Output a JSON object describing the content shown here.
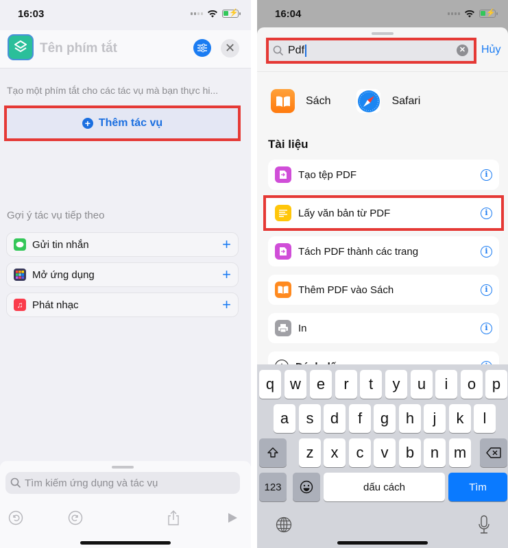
{
  "left": {
    "status": {
      "time": "16:03"
    },
    "header": {
      "title_placeholder": "Tên phím tắt",
      "app_icon": "shortcuts-layers-icon",
      "settings_icon": "sliders-icon",
      "close_icon": "close-icon"
    },
    "description": "Tạo một phím tắt cho các tác vụ mà bạn thực hi...",
    "add_action_label": "Thêm tác vụ",
    "suggestions_title": "Gợi ý tác vụ tiếp theo",
    "suggestions": [
      {
        "label": "Gửi tin nhắn",
        "icon": "messages-icon",
        "color": "#34c759"
      },
      {
        "label": "Mở ứng dụng",
        "icon": "app-grid-icon",
        "color": "#3a3a5c"
      },
      {
        "label": "Phát nhạc",
        "icon": "music-icon",
        "color": "#fa3c4c"
      }
    ],
    "search_placeholder": "Tìm kiếm ứng dụng và tác vụ",
    "toolbar": [
      "undo-icon",
      "redo-icon",
      "share-icon",
      "play-icon"
    ]
  },
  "right": {
    "status": {
      "time": "16:04"
    },
    "search": {
      "value": "Pdf",
      "cancel_label": "Hủy"
    },
    "apps": [
      {
        "label": "Sách",
        "icon": "books-icon",
        "color": "#ff8a1f"
      },
      {
        "label": "Safari",
        "icon": "safari-compass-icon",
        "color": "#1b7cf2"
      }
    ],
    "section_title": "Tài liệu",
    "actions": [
      {
        "label": "Tạo tệp PDF",
        "icon": "pdf-file-icon",
        "color": "#d04ed8",
        "highlighted": false
      },
      {
        "label": "Lấy văn bản từ PDF",
        "icon": "text-lines-icon",
        "color": "#ffc60a",
        "highlighted": true
      },
      {
        "label": "Tách PDF thành các trang",
        "icon": "pdf-file-icon",
        "color": "#d04ed8",
        "highlighted": false
      },
      {
        "label": "Thêm PDF vào Sách",
        "icon": "books-icon",
        "color": "#ff8a1f",
        "highlighted": false
      },
      {
        "label": "In",
        "icon": "printer-icon",
        "color": "#a0a0a5",
        "highlighted": false
      },
      {
        "label": "Đánh dấu",
        "icon": "markup-icon",
        "color": "#ffffff",
        "highlighted": false
      }
    ],
    "keyboard": {
      "row1": [
        "q",
        "w",
        "e",
        "r",
        "t",
        "y",
        "u",
        "i",
        "o",
        "p"
      ],
      "row2": [
        "a",
        "s",
        "d",
        "f",
        "g",
        "h",
        "j",
        "k",
        "l"
      ],
      "row3": [
        "z",
        "x",
        "c",
        "v",
        "b",
        "n",
        "m"
      ],
      "numbers_label": "123",
      "space_label": "dấu cách",
      "search_label": "Tìm"
    }
  }
}
